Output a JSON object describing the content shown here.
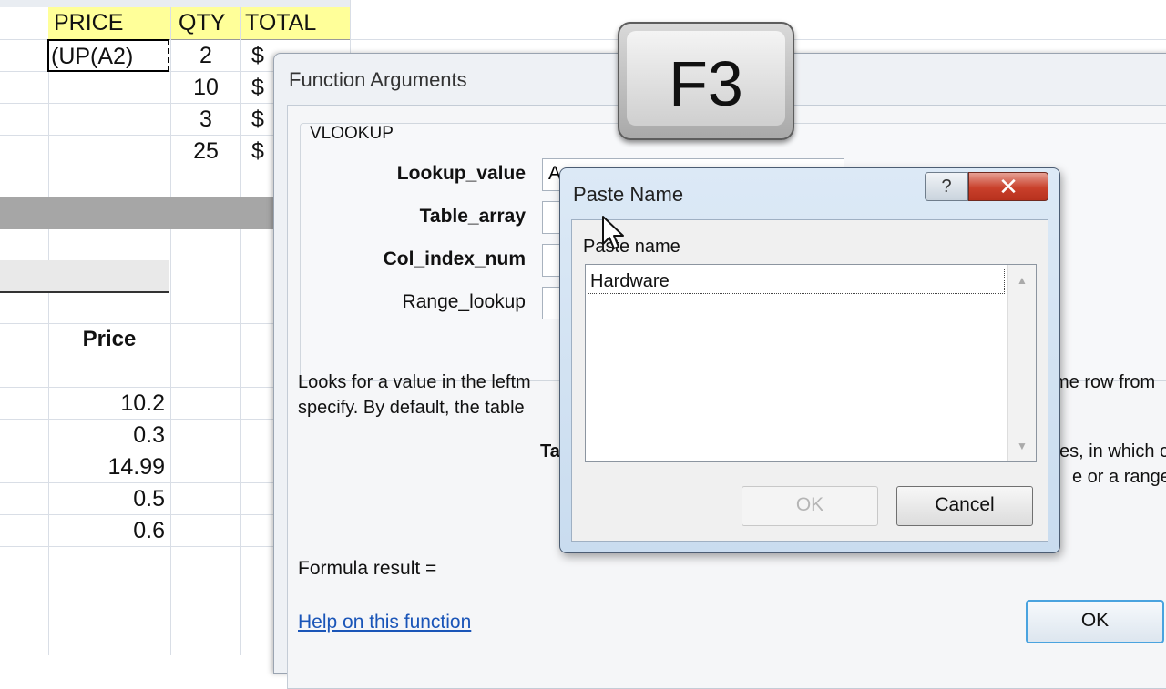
{
  "sheet": {
    "headers": {
      "price": "PRICE",
      "qty": "QTY",
      "total": "TOTAL"
    },
    "active_cell": "(UP(A2)",
    "qty_values": [
      "2",
      "10",
      "3",
      "25"
    ],
    "currency_symbol": "$",
    "price_heading": "Price",
    "price_values": [
      "10.2",
      "0.3",
      "14.99",
      "0.5",
      "0.6"
    ]
  },
  "function_arguments": {
    "title": "Function Arguments",
    "function_name": "VLOOKUP",
    "args": {
      "lookup_value": "Lookup_value",
      "table_array": "Table_array",
      "col_index_num": "Col_index_num",
      "range_lookup": "Range_lookup"
    },
    "lookup_value_input": "A",
    "description_line1": "Looks for a value in the leftm",
    "description_line2": "specify. By default, the table",
    "description_right1": "me row from",
    "description_right2": "es, in which c",
    "description_right3": "e or a range",
    "arg_detail_label": "Ta",
    "formula_result_label": "Formula result =",
    "help_link": "Help on this function",
    "ok_label": "OK"
  },
  "key_overlay": {
    "label": "F3"
  },
  "paste_name": {
    "title": "Paste Name",
    "help_label": "?",
    "close_label": "✕",
    "list_label": "Paste name",
    "items": [
      "Hardware"
    ],
    "ok_label": "OK",
    "cancel_label": "Cancel"
  },
  "colors": {
    "header_fill": "#ffff99",
    "close_button": "#c9402b",
    "link": "#1a55b8",
    "focus_border": "#4aa3df"
  }
}
